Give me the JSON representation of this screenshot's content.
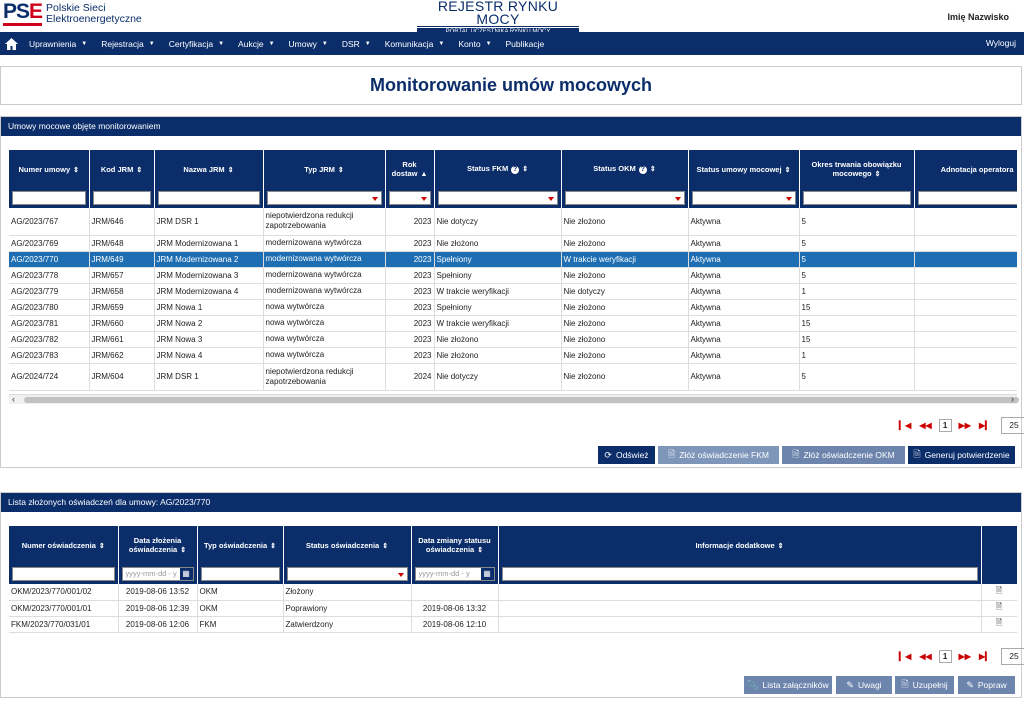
{
  "header": {
    "logo_mark_a": "PS",
    "logo_mark_b": "E",
    "logo_line1": "Polskie Sieci",
    "logo_line2": "Elektroenergetyczne",
    "title_line1": "REJESTR RYNKU MOCY",
    "title_line2": "PORTAL UCZESTNIKA RYNKU MOCY",
    "user": "Imię Nazwisko"
  },
  "nav": {
    "items": [
      "Uprawnienia",
      "Rejestracja",
      "Certyfikacja",
      "Aukcje",
      "Umowy",
      "DSR",
      "Komunikacja",
      "Konto",
      "Publikacje"
    ],
    "has_caret": [
      true,
      true,
      true,
      true,
      true,
      true,
      true,
      true,
      false
    ],
    "logout": "Wyloguj"
  },
  "page_title": "Monitorowanie umów mocowych",
  "contracts": {
    "heading": "Umowy mocowe objęte monitorowaniem",
    "columns": [
      "Numer umowy",
      "Kod JRM",
      "Nazwa JRM",
      "Typ JRM",
      "Rok dostaw",
      "Status FKM",
      "Status OKM",
      "Status umowy mocowej",
      "Okres trwania obowiązku mocowego",
      "Adnotacja operatora"
    ],
    "rows": [
      [
        "AG/2023/767",
        "JRM/646",
        "JRM DSR 1",
        "niepotwierdzona redukcji zapotrzebowania",
        "2023",
        "Nie dotyczy",
        "Nie złożono",
        "Aktywna",
        "5",
        ""
      ],
      [
        "AG/2023/769",
        "JRM/648",
        "JRM Modernizowana 1",
        "modernizowana wytwórcza",
        "2023",
        "Nie złożono",
        "Nie złożono",
        "Aktywna",
        "5",
        ""
      ],
      [
        "AG/2023/770",
        "JRM/649",
        "JRM Modernizowana 2",
        "modernizowana wytwórcza",
        "2023",
        "Spełniony",
        "W trakcie weryfikacji",
        "Aktywna",
        "5",
        ""
      ],
      [
        "AG/2023/778",
        "JRM/657",
        "JRM Modernizowana 3",
        "modernizowana wytwórcza",
        "2023",
        "Spełniony",
        "Nie złożono",
        "Aktywna",
        "5",
        ""
      ],
      [
        "AG/2023/779",
        "JRM/658",
        "JRM Modernizowana 4",
        "modernizowana wytwórcza",
        "2023",
        "W trakcie weryfikacji",
        "Nie dotyczy",
        "Aktywna",
        "1",
        ""
      ],
      [
        "AG/2023/780",
        "JRM/659",
        "JRM Nowa 1",
        "nowa wytwórcza",
        "2023",
        "Spełniony",
        "Nie złożono",
        "Aktywna",
        "15",
        ""
      ],
      [
        "AG/2023/781",
        "JRM/660",
        "JRM Nowa 2",
        "nowa wytwórcza",
        "2023",
        "W trakcie weryfikacji",
        "Nie złożono",
        "Aktywna",
        "15",
        ""
      ],
      [
        "AG/2023/782",
        "JRM/661",
        "JRM Nowa 3",
        "nowa wytwórcza",
        "2023",
        "Nie złożono",
        "Nie złożono",
        "Aktywna",
        "15",
        ""
      ],
      [
        "AG/2023/783",
        "JRM/662",
        "JRM Nowa 4",
        "nowa wytwórcza",
        "2023",
        "Nie złożono",
        "Nie złożono",
        "Aktywna",
        "1",
        ""
      ],
      [
        "AG/2024/724",
        "JRM/604",
        "JRM DSR 1",
        "niepotwierdzona redukcji zapotrzebowania",
        "2024",
        "Nie dotyczy",
        "Nie złożono",
        "Aktywna",
        "5",
        ""
      ]
    ],
    "selected_row": 2,
    "pager": {
      "page": "1",
      "page_size": "25"
    },
    "buttons": {
      "refresh": "Odśwież",
      "fkm": "Złóż oświadczenie FKM",
      "okm": "Złóż oświadczenie OKM",
      "confirm": "Generuj potwierdzenie"
    }
  },
  "declarations": {
    "heading": "Lista złożonych oświadczeń dla umowy: AG/2023/770",
    "columns": [
      "Numer oświadczenia",
      "Data złożenia oświadczenia",
      "Typ oświadczenia",
      "Status oświadczenia",
      "Data zmiany statusu oświadczenia",
      "Informacje dodatkowe"
    ],
    "date_placeholder": "yyyy-mm-dd - y",
    "rows": [
      [
        "OKM/2023/770/001/02",
        "2019-08-06 13:52",
        "OKM",
        "Złożony",
        "",
        ""
      ],
      [
        "OKM/2023/770/001/01",
        "2019-08-06 12:39",
        "OKM",
        "Poprawiony",
        "2019-08-06 13:32",
        ""
      ],
      [
        "FKM/2023/770/031/01",
        "2019-08-06 12:06",
        "FKM",
        "Zatwierdzony",
        "2019-08-06 12:10",
        ""
      ]
    ],
    "pager": {
      "page": "1",
      "page_size": "25"
    },
    "buttons": {
      "attachments": "Lista załączników",
      "remarks": "Uwagi",
      "supplement": "Uzupełnij",
      "correct": "Popraw"
    }
  }
}
